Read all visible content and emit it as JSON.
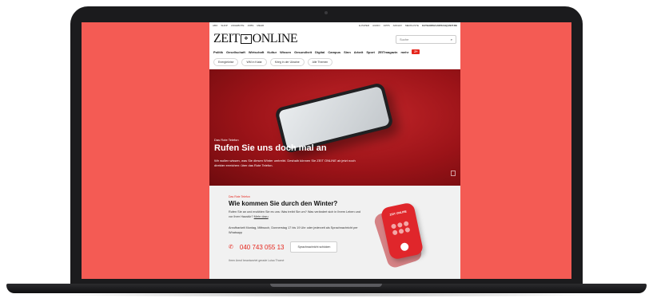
{
  "topbar": {
    "left": [
      "ABO",
      "SHOP",
      "ANGEBOTE",
      "JOBS",
      "MEHR"
    ],
    "right": [
      "E-PAPER",
      "AUDIO",
      "APPS",
      "ARCHIV",
      "MERKLISTE"
    ],
    "user": "KATHARINA.KIRSCH@ZEIT.DE"
  },
  "logo": {
    "left": "ZEIT",
    "right": "ONLINE"
  },
  "search": {
    "placeholder": "Suche"
  },
  "nav": {
    "items": [
      "Politik",
      "Gesellschaft",
      "Wirtschaft",
      "Kultur",
      "Wissen",
      "Gesundheit",
      "Digital",
      "Campus",
      "Sinn",
      "Arbeit",
      "Sport",
      "ZEITmagazin",
      "mehr"
    ],
    "abo_label": "Z+"
  },
  "chips": [
    "Energiekrise",
    "WM in Katar",
    "Krieg in der Ukraine",
    "Alle Themen"
  ],
  "hero": {
    "kicker": "Das Rote Telefon",
    "title": "Rufen Sie uns doch mal an",
    "text": "Wir wollen wissen, was Sie diesen Winter umtreibt. Deshalb können Sie ZEIT ONLINE ab jetzt noch direkter erreichen: über das Rote Telefon."
  },
  "section": {
    "kicker": "Das Rote Telefon",
    "title": "Wie kommen Sie durch den Winter?",
    "text": "Rufen Sie an und erzählen Sie es uns: Was treibt Sie um? Was verändert sich in Ihrem Leben und vor Ihrer Haustür?",
    "link": "Mehr dazu",
    "text2": "Anrufbarkeit Montag, Mittwoch, Donnerstag 17 bis 19 Uhr oder jederzeit als Sprachnachricht per Whatsapp",
    "phone": "040 743 055 13",
    "button": "Sprachnachricht schicken",
    "footer": "Ihren Anruf beantwortet gerade Luisa Thomé",
    "device_brand": "ZEIT ONLINE"
  },
  "colors": {
    "background": "#f45b54",
    "accent": "#e5261d"
  }
}
